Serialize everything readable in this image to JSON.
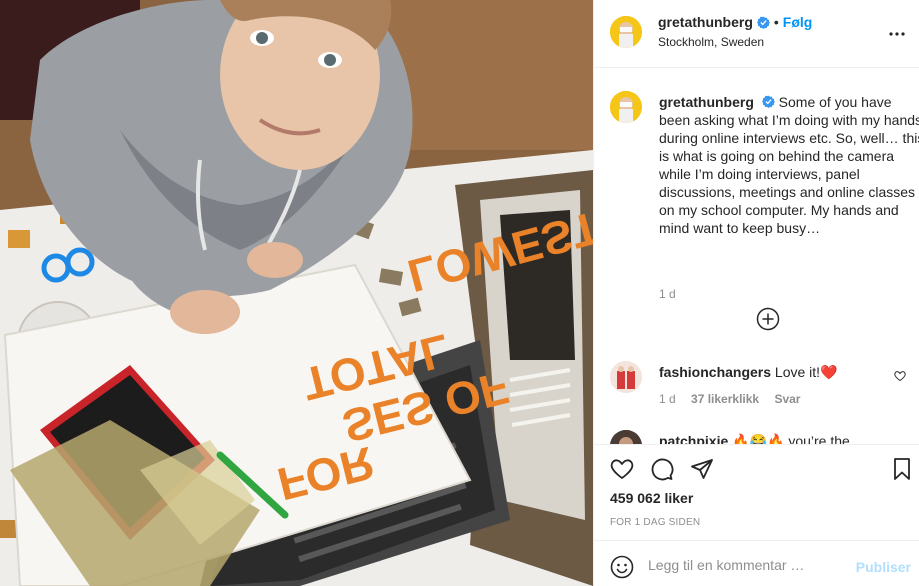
{
  "post": {
    "username": "gretathunberg",
    "follow_label": "Følg",
    "separator": "•",
    "location": "Stockholm, Sweden",
    "caption": "Some of you have been asking what I’m doing with my hands during online interviews etc. So, well… this is what is going on behind the camera while I’m doing interviews, panel discussions, meetings and online classes on my school computer. My hands and mind want to keep busy…",
    "caption_time": "1 d",
    "likes": "459 062 liker",
    "date": "FOR 1 DAG SIDEN"
  },
  "comments": [
    {
      "username": "fashionchangers",
      "text": "Love it!❤️",
      "time": "1 d",
      "likes": "37 likerklikk",
      "reply": "Svar"
    },
    {
      "username": "patchpixie",
      "text": "🔥😂🔥 you’re the"
    }
  ],
  "add_comment": {
    "placeholder": "Legg til en kommentar …",
    "publish_label": "Publiser"
  },
  "photo": {
    "embroidery_lines": [
      "LOWEST",
      "TOTAL",
      "SES OF",
      "FOR"
    ]
  },
  "colors": {
    "accent": "#0095f6",
    "publish_disabled": "#b2dffc",
    "secondary_text": "#8e8e8e",
    "heart_red": "#ed4956"
  },
  "icons": [
    "verified-icon",
    "more-options-icon",
    "load-more-comments-icon",
    "like-heart-icon",
    "comment-icon",
    "share-icon",
    "save-bookmark-icon",
    "emoji-icon",
    "comment-heart-icon"
  ]
}
